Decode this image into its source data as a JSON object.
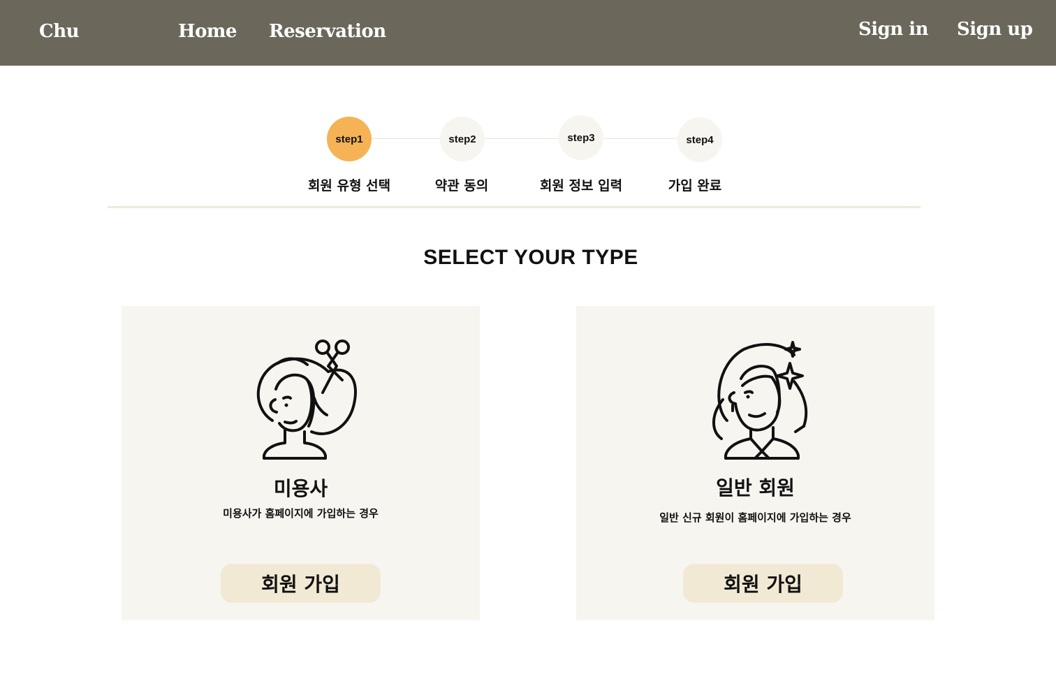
{
  "header": {
    "logo": "Chu",
    "nav": {
      "home": "Home",
      "reservation": "Reservation"
    },
    "auth": {
      "sign_in": "Sign in",
      "sign_up": "Sign up"
    },
    "background_color": "#6c675b"
  },
  "steps": [
    {
      "badge": "step1",
      "label": "회원 유형 선택",
      "active": true
    },
    {
      "badge": "step2",
      "label": "약관 동의",
      "active": false
    },
    {
      "badge": "step3",
      "label": "회원 정보 입력",
      "active": false
    },
    {
      "badge": "step4",
      "label": "가입 완료",
      "active": false
    }
  ],
  "accent_color": "#f5b356",
  "section_title": "SELECT YOUR TYPE",
  "cards": [
    {
      "icon": "hairdresser-icon",
      "title": "미용사",
      "description": "미용사가 홈페이지에 가입하는 경우",
      "button_label": "회원 가입"
    },
    {
      "icon": "woman-user-icon",
      "title": "일반 회원",
      "description": "일반 신규 회원이 홈페이지에 가입하는 경우",
      "button_label": "회원 가입"
    }
  ]
}
